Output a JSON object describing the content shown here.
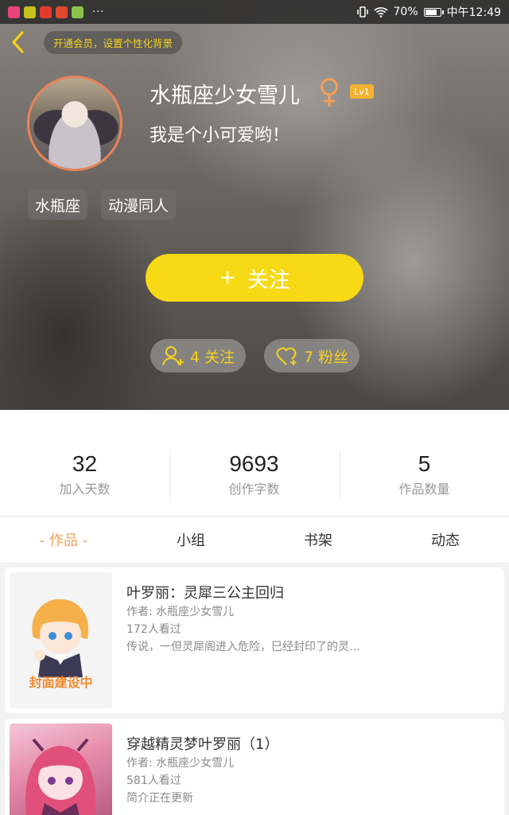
{
  "status_bar": {
    "more": "···",
    "battery": "70%",
    "time": "中午12:49",
    "battery_level": 0.7
  },
  "header": {
    "vip_promo": "开通会员，设置个性化背景",
    "username": "水瓶座少女雪儿",
    "gender_symbol": "♀",
    "level": "Lv1",
    "bio": "我是个小可爱哟！",
    "tags": [
      "水瓶座",
      "动漫同人"
    ],
    "follow_button": {
      "plus": "+",
      "label": "关注"
    },
    "following": "4 关注",
    "fans": "7 粉丝"
  },
  "stats": [
    {
      "value": "32",
      "label": "加入天数"
    },
    {
      "value": "9693",
      "label": "创作字数"
    },
    {
      "value": "5",
      "label": "作品数量"
    }
  ],
  "tabs": [
    "- 作品 -",
    "小组",
    "书架",
    "动态"
  ],
  "works": [
    {
      "title": "叶罗丽：灵犀三公主回归",
      "author": "作者: 水瓶座少女雪儿",
      "views": "172人看过",
      "summary": "传说，一但灵犀阁进入危险，巳经封印了的灵…",
      "cover_text": "封面建设中"
    },
    {
      "title": "穿越精灵梦叶罗丽（1）",
      "author": "作者: 水瓶座少女雪儿",
      "views": "581人看过",
      "summary": "简介正在更新"
    }
  ],
  "colors": {
    "accent_yellow": "#f7d916",
    "tab_active": "#f5a05a",
    "gender": "#f5a05a",
    "level_badge": "#f5b130"
  }
}
